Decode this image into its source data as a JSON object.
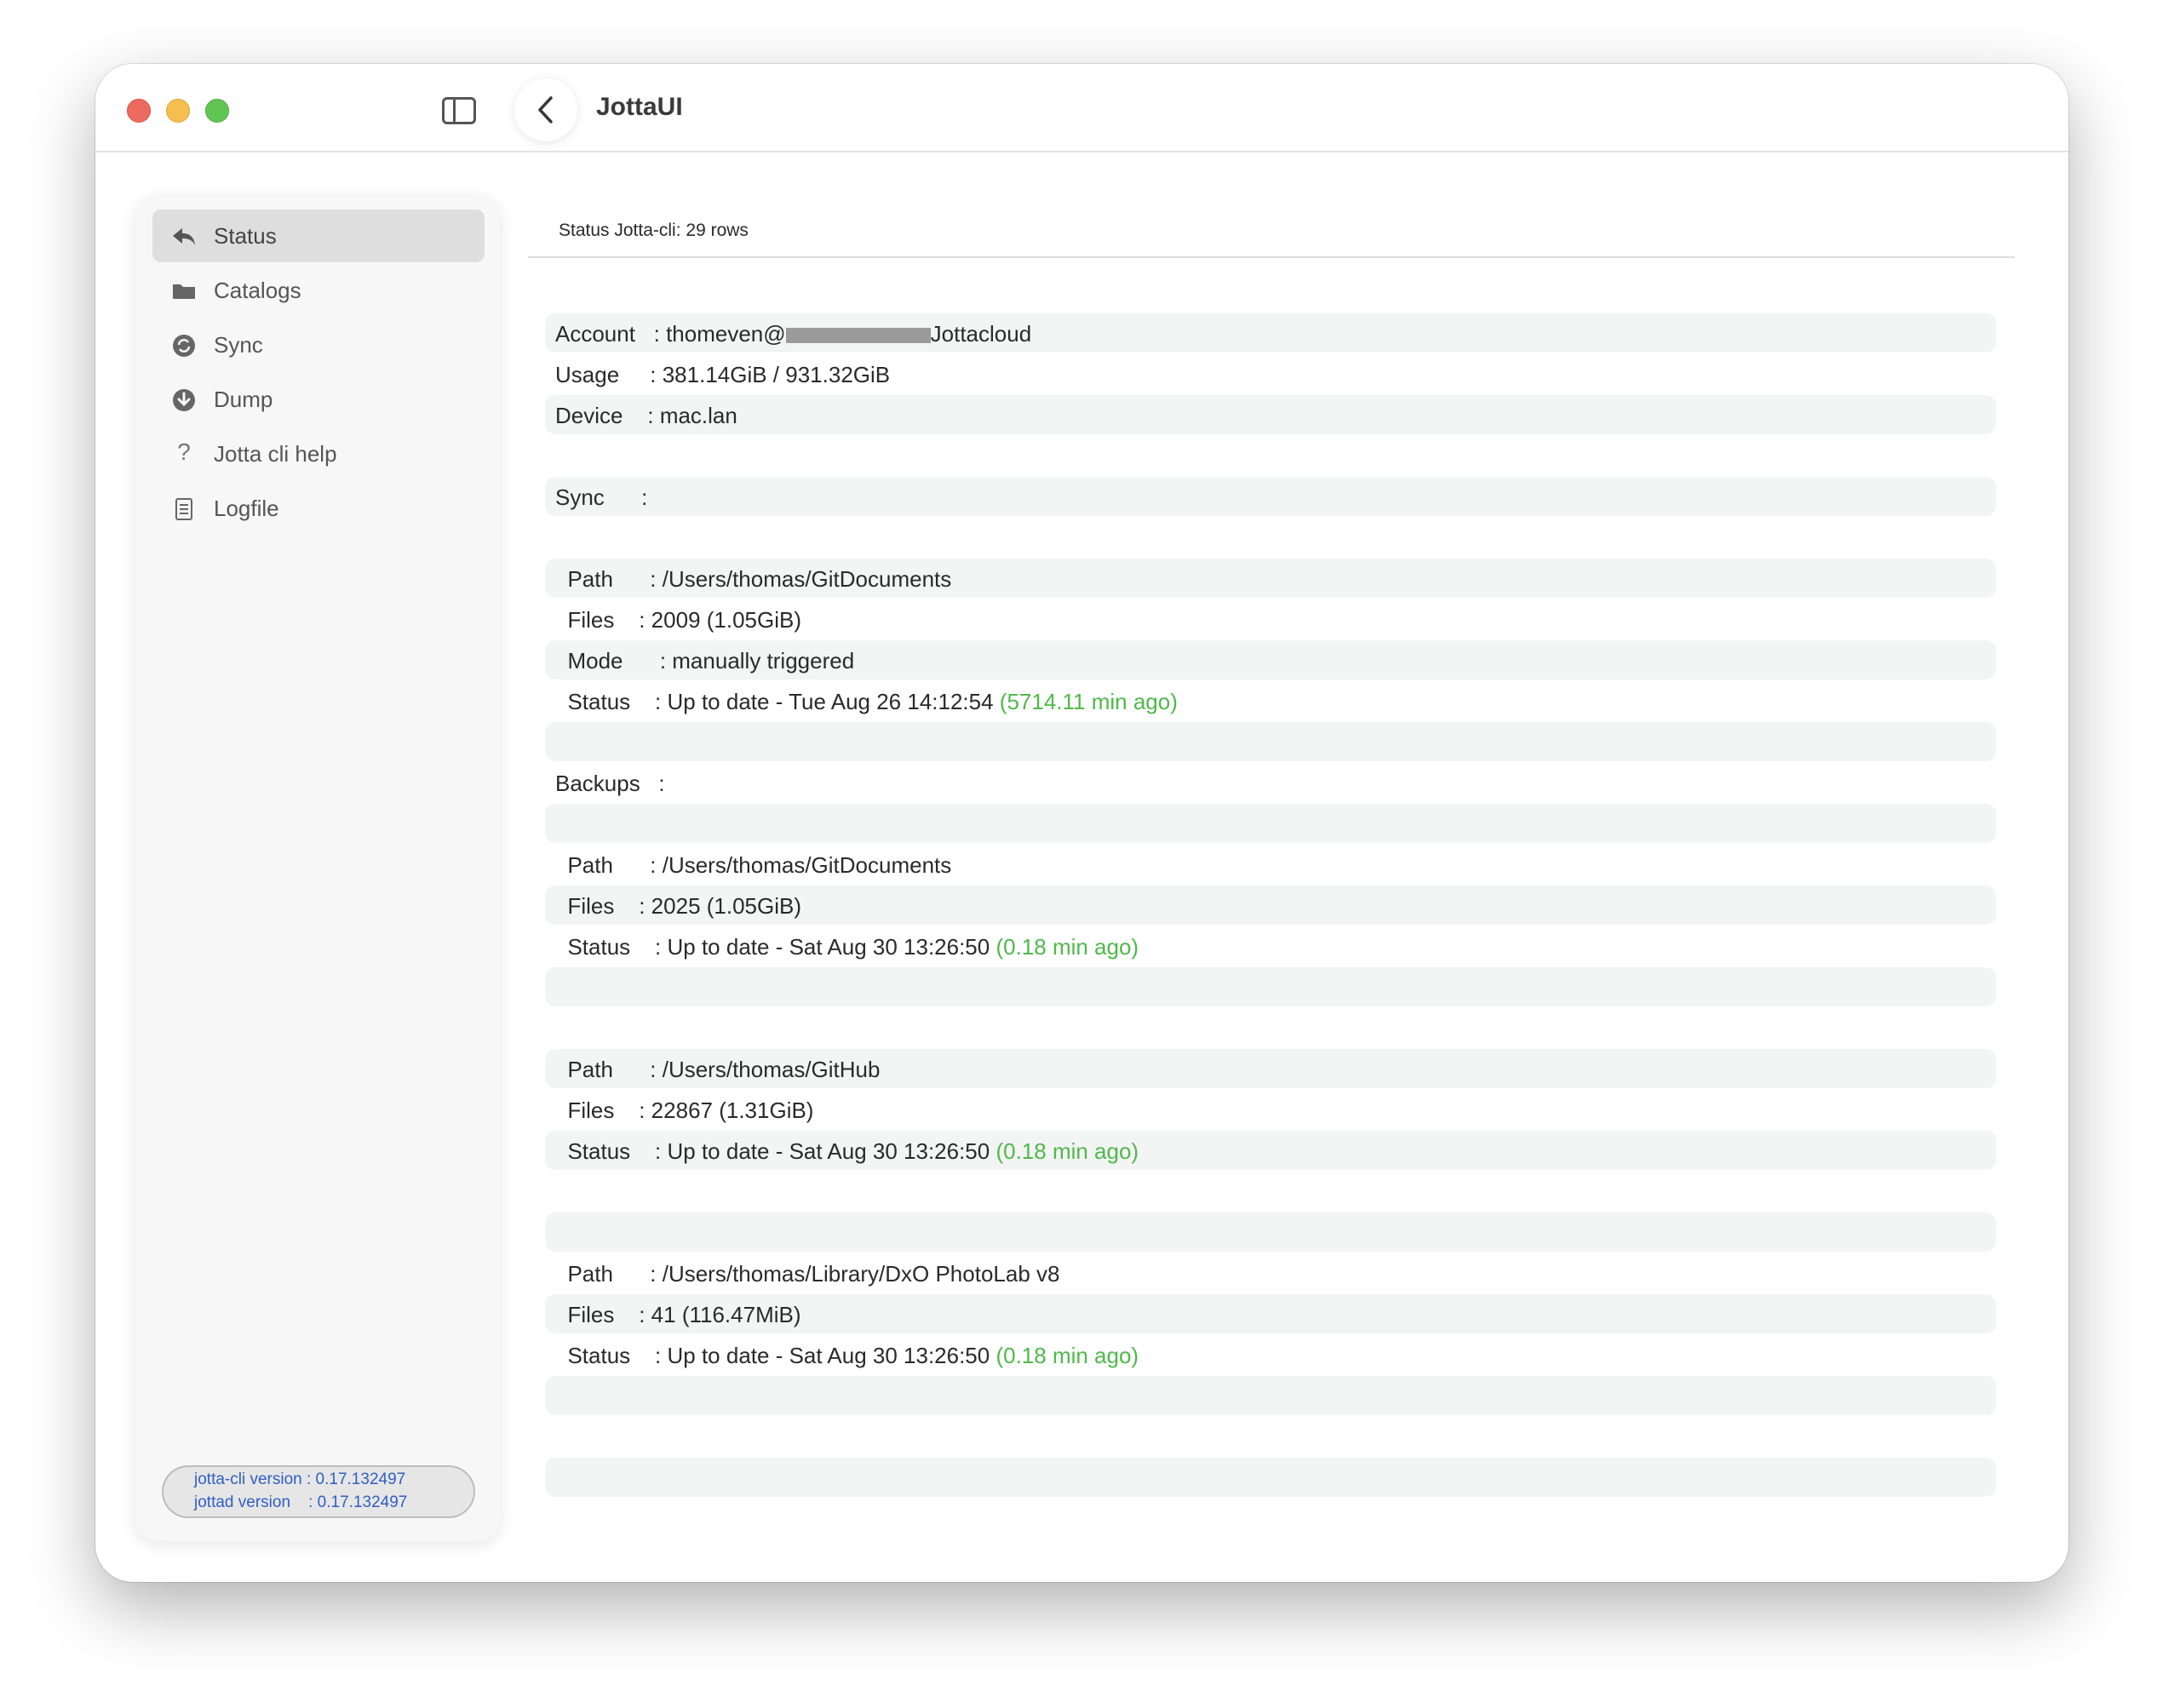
{
  "window": {
    "title": "JottaUI"
  },
  "sidebar": {
    "items": [
      {
        "label": "Status",
        "icon": "reply-arrow-icon",
        "active": true
      },
      {
        "label": "Catalogs",
        "icon": "folder-icon",
        "active": false
      },
      {
        "label": "Sync",
        "icon": "sync-icon",
        "active": false
      },
      {
        "label": "Dump",
        "icon": "download-icon",
        "active": false
      },
      {
        "label": "Jotta cli help",
        "icon": "question-mark-icon",
        "active": false
      },
      {
        "label": "Logfile",
        "icon": "document-icon",
        "active": false
      }
    ],
    "version": {
      "cli": "jotta-cli version : 0.17.132497",
      "daemon": "jottad version    : 0.17.132497"
    }
  },
  "main": {
    "header": "Status Jotta-cli: 29 rows",
    "rows": [
      {
        "text": "Account   : thomeven@",
        "suffix": "Jottacloud",
        "redacted": true
      },
      {
        "text": "Usage     : 381.14GiB / 931.32GiB"
      },
      {
        "text": "Device    : mac.lan"
      },
      {
        "text": ""
      },
      {
        "text": "Sync      :"
      },
      {
        "text": ""
      },
      {
        "text": "  Path      : /Users/thomas/GitDocuments"
      },
      {
        "text": "  Files    : 2009 (1.05GiB)"
      },
      {
        "text": "  Mode      : manually triggered"
      },
      {
        "text": "  Status    : Up to date - Tue Aug 26 14:12:54 ",
        "green": "(5714.11 min ago)"
      },
      {
        "text": ""
      },
      {
        "text": "Backups   :"
      },
      {
        "text": ""
      },
      {
        "text": "  Path      : /Users/thomas/GitDocuments"
      },
      {
        "text": "  Files    : 2025 (1.05GiB)"
      },
      {
        "text": "  Status    : Up to date - Sat Aug 30 13:26:50 ",
        "green": "(0.18 min ago)"
      },
      {
        "text": ""
      },
      {
        "text": ""
      },
      {
        "text": "  Path      : /Users/thomas/GitHub"
      },
      {
        "text": "  Files    : 22867 (1.31GiB)"
      },
      {
        "text": "  Status    : Up to date - Sat Aug 30 13:26:50 ",
        "green": "(0.18 min ago)"
      },
      {
        "text": ""
      },
      {
        "text": ""
      },
      {
        "text": "  Path      : /Users/thomas/Library/DxO PhotoLab v8"
      },
      {
        "text": "  Files    : 41 (116.47MiB)"
      },
      {
        "text": "  Status    : Up to date - Sat Aug 30 13:26:50 ",
        "green": "(0.18 min ago)"
      },
      {
        "text": ""
      },
      {
        "text": ""
      },
      {
        "text": ""
      }
    ]
  },
  "colors": {
    "accent_green": "#4fb94a",
    "version_blue": "#2f5fc4",
    "row_shade": "#f3f4f4"
  }
}
